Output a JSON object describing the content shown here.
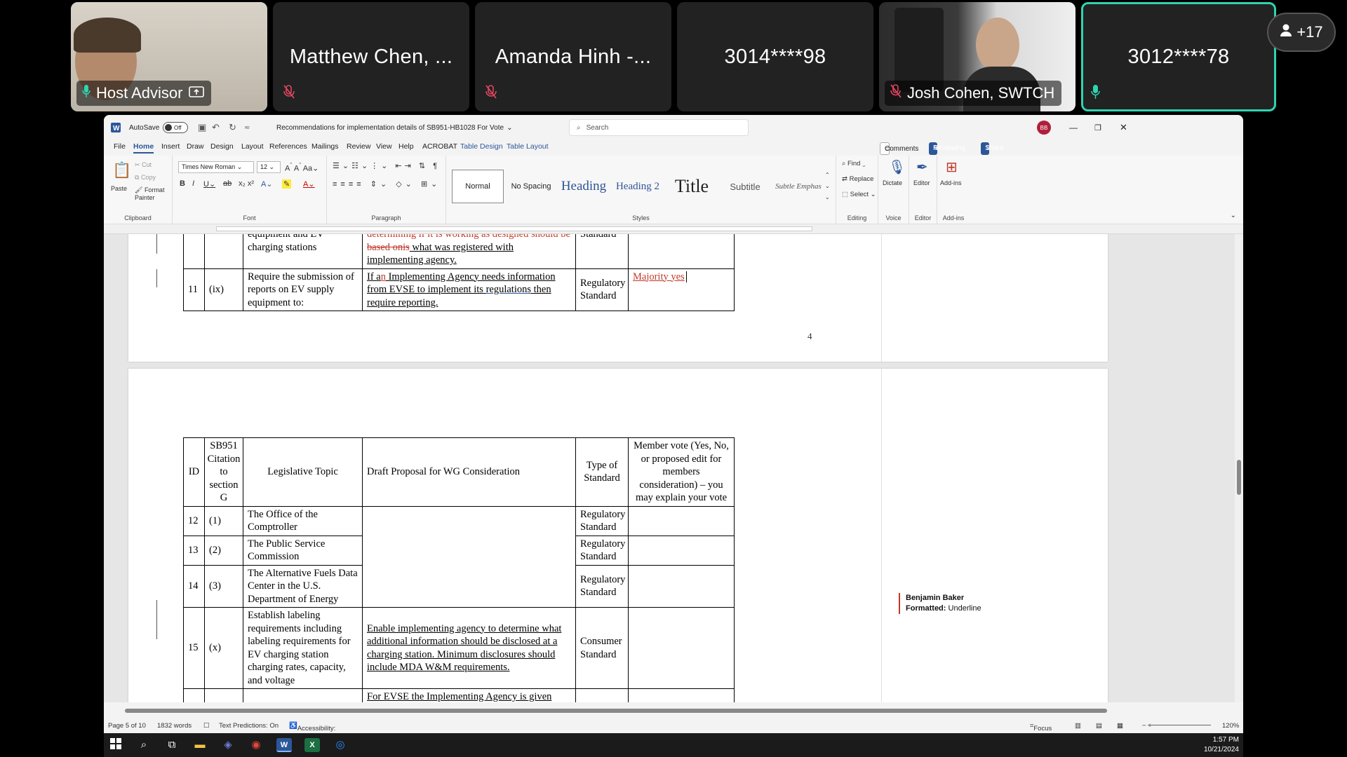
{
  "participants": [
    {
      "name": "Host Advisor",
      "label": true,
      "active": true
    },
    {
      "name": "Matthew Chen, ..."
    },
    {
      "name": "Amanda Hinh -..."
    },
    {
      "name": "3014****98"
    },
    {
      "name": "Josh Cohen, SWTCH",
      "label": true
    },
    {
      "name": "3012****78",
      "active": true
    }
  ],
  "more_participants": "+17",
  "word": {
    "autosave": "AutoSave",
    "autosave_state": "Off",
    "doc_title": "Recommendations for implementation details of SB951-HB1028 For Vote",
    "search_placeholder": "Search",
    "user_initials": "BB",
    "menu": [
      "File",
      "Home",
      "Insert",
      "Draw",
      "Design",
      "Layout",
      "References",
      "Mailings",
      "Review",
      "View",
      "Help",
      "ACROBAT",
      "Table Design",
      "Table Layout"
    ],
    "comments_btn": "Comments",
    "reviewing_btn": "Reviewing",
    "share_btn": "Share",
    "clipboard": {
      "paste": "Paste",
      "cut": "Cut",
      "copy": "Copy",
      "format_painter": "Format Painter",
      "label": "Clipboard"
    },
    "font": {
      "name": "Times New Roman",
      "size": "12",
      "label": "Font"
    },
    "paragraph_label": "Paragraph",
    "styles": [
      "Normal",
      "No Spacing",
      "Heading",
      "Heading 2",
      "Title",
      "Subtitle",
      "Subtle Emphas"
    ],
    "styles_label": "Styles",
    "editing": {
      "find": "Find",
      "replace": "Replace",
      "select": "Select",
      "label": "Editing"
    },
    "voice": {
      "dictate": "Dictate",
      "label": "Voice"
    },
    "editor": {
      "name": "Editor",
      "label": "Editor"
    },
    "addins": {
      "name": "Add-ins",
      "label": "Add-ins"
    }
  },
  "doc": {
    "page_number": "4",
    "top_table": {
      "row10": {
        "topic": "equipment and EV charging stations",
        "draft_del": "determining if it is working as designed should be based on",
        "draft_del2": "is",
        "draft_rest": " what was registered with implementing agency.",
        "type": "Standard"
      },
      "row11": {
        "id": "11",
        "citation": "(ix)",
        "topic": "Require the submission of reports on EV supply equipment to:",
        "draft_pre": "If a",
        "draft_ins": "n",
        "draft_mid": " Implementing Agency needs information from EVSE to implement its ",
        "draft_link": "regulations",
        "draft_post": " then require reporting.",
        "type": "Regulatory Standard",
        "vote": "Majority yes"
      }
    },
    "table2": {
      "headers": [
        "ID",
        "SB951 Citation to section G",
        "Legislative Topic",
        "Draft Proposal for WG Consideration",
        "Type of Standard",
        "Member vote (Yes, No, or proposed edit for members consideration) – you may explain your vote"
      ],
      "rows": [
        {
          "id": "12",
          "cit": "(1)",
          "topic": "The Office of the Comptroller",
          "type": "Regulatory Standard"
        },
        {
          "id": "13",
          "cit": "(2)",
          "topic": "The Public Service Commission",
          "type": "Regulatory Standard"
        },
        {
          "id": "14",
          "cit": "(3)",
          "topic": "The Alternative Fuels Data Center in the U.S. Department of Energy",
          "type": "Regulatory Standard"
        },
        {
          "id": "15",
          "cit": "(x)",
          "topic": "Establish labeling requirements including labeling requirements for EV charging station charging rates, capacity, and voltage",
          "draft": "Enable implementing agency to determine what additional information should be disclosed at a charging station.  Minimum disclosures should include MDA W&M requirements.",
          "type": "Consumer Standard"
        }
      ],
      "partial_row": "For EVSE the Implementing Agency is given"
    },
    "comment": {
      "author": "Benjamin Baker",
      "label": "Formatted:",
      "value": "Underline"
    }
  },
  "status": {
    "page": "Page 5 of 10",
    "words": "1832 words",
    "predictions": "Text Predictions: On",
    "accessibility": "Accessibility: Investigate",
    "focus": "Focus",
    "zoom": "120%"
  },
  "clock": {
    "time": "1:57 PM",
    "date": "10/21/2024"
  }
}
